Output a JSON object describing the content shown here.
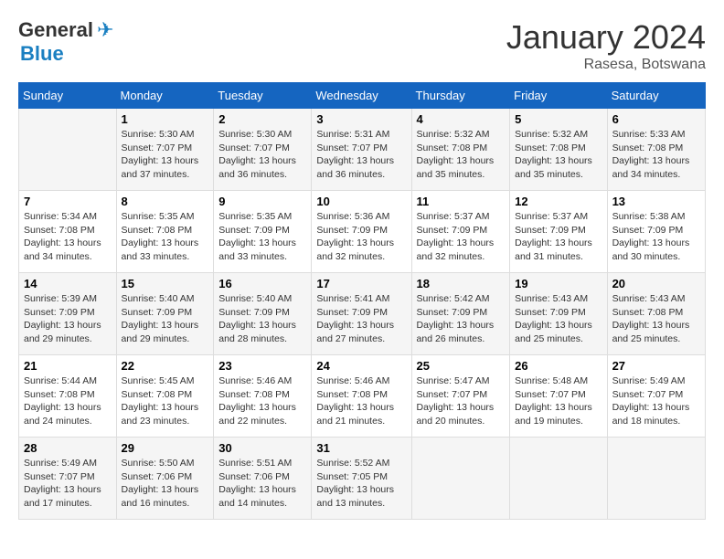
{
  "header": {
    "logo_general": "General",
    "logo_blue": "Blue",
    "month_title": "January 2024",
    "location": "Rasesa, Botswana"
  },
  "columns": [
    "Sunday",
    "Monday",
    "Tuesday",
    "Wednesday",
    "Thursday",
    "Friday",
    "Saturday"
  ],
  "weeks": [
    [
      {
        "day": "",
        "sunrise": "",
        "sunset": "",
        "daylight": ""
      },
      {
        "day": "1",
        "sunrise": "Sunrise: 5:30 AM",
        "sunset": "Sunset: 7:07 PM",
        "daylight": "Daylight: 13 hours and 37 minutes."
      },
      {
        "day": "2",
        "sunrise": "Sunrise: 5:30 AM",
        "sunset": "Sunset: 7:07 PM",
        "daylight": "Daylight: 13 hours and 36 minutes."
      },
      {
        "day": "3",
        "sunrise": "Sunrise: 5:31 AM",
        "sunset": "Sunset: 7:07 PM",
        "daylight": "Daylight: 13 hours and 36 minutes."
      },
      {
        "day": "4",
        "sunrise": "Sunrise: 5:32 AM",
        "sunset": "Sunset: 7:08 PM",
        "daylight": "Daylight: 13 hours and 35 minutes."
      },
      {
        "day": "5",
        "sunrise": "Sunrise: 5:32 AM",
        "sunset": "Sunset: 7:08 PM",
        "daylight": "Daylight: 13 hours and 35 minutes."
      },
      {
        "day": "6",
        "sunrise": "Sunrise: 5:33 AM",
        "sunset": "Sunset: 7:08 PM",
        "daylight": "Daylight: 13 hours and 34 minutes."
      }
    ],
    [
      {
        "day": "7",
        "sunrise": "Sunrise: 5:34 AM",
        "sunset": "Sunset: 7:08 PM",
        "daylight": "Daylight: 13 hours and 34 minutes."
      },
      {
        "day": "8",
        "sunrise": "Sunrise: 5:35 AM",
        "sunset": "Sunset: 7:08 PM",
        "daylight": "Daylight: 13 hours and 33 minutes."
      },
      {
        "day": "9",
        "sunrise": "Sunrise: 5:35 AM",
        "sunset": "Sunset: 7:09 PM",
        "daylight": "Daylight: 13 hours and 33 minutes."
      },
      {
        "day": "10",
        "sunrise": "Sunrise: 5:36 AM",
        "sunset": "Sunset: 7:09 PM",
        "daylight": "Daylight: 13 hours and 32 minutes."
      },
      {
        "day": "11",
        "sunrise": "Sunrise: 5:37 AM",
        "sunset": "Sunset: 7:09 PM",
        "daylight": "Daylight: 13 hours and 32 minutes."
      },
      {
        "day": "12",
        "sunrise": "Sunrise: 5:37 AM",
        "sunset": "Sunset: 7:09 PM",
        "daylight": "Daylight: 13 hours and 31 minutes."
      },
      {
        "day": "13",
        "sunrise": "Sunrise: 5:38 AM",
        "sunset": "Sunset: 7:09 PM",
        "daylight": "Daylight: 13 hours and 30 minutes."
      }
    ],
    [
      {
        "day": "14",
        "sunrise": "Sunrise: 5:39 AM",
        "sunset": "Sunset: 7:09 PM",
        "daylight": "Daylight: 13 hours and 29 minutes."
      },
      {
        "day": "15",
        "sunrise": "Sunrise: 5:40 AM",
        "sunset": "Sunset: 7:09 PM",
        "daylight": "Daylight: 13 hours and 29 minutes."
      },
      {
        "day": "16",
        "sunrise": "Sunrise: 5:40 AM",
        "sunset": "Sunset: 7:09 PM",
        "daylight": "Daylight: 13 hours and 28 minutes."
      },
      {
        "day": "17",
        "sunrise": "Sunrise: 5:41 AM",
        "sunset": "Sunset: 7:09 PM",
        "daylight": "Daylight: 13 hours and 27 minutes."
      },
      {
        "day": "18",
        "sunrise": "Sunrise: 5:42 AM",
        "sunset": "Sunset: 7:09 PM",
        "daylight": "Daylight: 13 hours and 26 minutes."
      },
      {
        "day": "19",
        "sunrise": "Sunrise: 5:43 AM",
        "sunset": "Sunset: 7:09 PM",
        "daylight": "Daylight: 13 hours and 25 minutes."
      },
      {
        "day": "20",
        "sunrise": "Sunrise: 5:43 AM",
        "sunset": "Sunset: 7:08 PM",
        "daylight": "Daylight: 13 hours and 25 minutes."
      }
    ],
    [
      {
        "day": "21",
        "sunrise": "Sunrise: 5:44 AM",
        "sunset": "Sunset: 7:08 PM",
        "daylight": "Daylight: 13 hours and 24 minutes."
      },
      {
        "day": "22",
        "sunrise": "Sunrise: 5:45 AM",
        "sunset": "Sunset: 7:08 PM",
        "daylight": "Daylight: 13 hours and 23 minutes."
      },
      {
        "day": "23",
        "sunrise": "Sunrise: 5:46 AM",
        "sunset": "Sunset: 7:08 PM",
        "daylight": "Daylight: 13 hours and 22 minutes."
      },
      {
        "day": "24",
        "sunrise": "Sunrise: 5:46 AM",
        "sunset": "Sunset: 7:08 PM",
        "daylight": "Daylight: 13 hours and 21 minutes."
      },
      {
        "day": "25",
        "sunrise": "Sunrise: 5:47 AM",
        "sunset": "Sunset: 7:07 PM",
        "daylight": "Daylight: 13 hours and 20 minutes."
      },
      {
        "day": "26",
        "sunrise": "Sunrise: 5:48 AM",
        "sunset": "Sunset: 7:07 PM",
        "daylight": "Daylight: 13 hours and 19 minutes."
      },
      {
        "day": "27",
        "sunrise": "Sunrise: 5:49 AM",
        "sunset": "Sunset: 7:07 PM",
        "daylight": "Daylight: 13 hours and 18 minutes."
      }
    ],
    [
      {
        "day": "28",
        "sunrise": "Sunrise: 5:49 AM",
        "sunset": "Sunset: 7:07 PM",
        "daylight": "Daylight: 13 hours and 17 minutes."
      },
      {
        "day": "29",
        "sunrise": "Sunrise: 5:50 AM",
        "sunset": "Sunset: 7:06 PM",
        "daylight": "Daylight: 13 hours and 16 minutes."
      },
      {
        "day": "30",
        "sunrise": "Sunrise: 5:51 AM",
        "sunset": "Sunset: 7:06 PM",
        "daylight": "Daylight: 13 hours and 14 minutes."
      },
      {
        "day": "31",
        "sunrise": "Sunrise: 5:52 AM",
        "sunset": "Sunset: 7:05 PM",
        "daylight": "Daylight: 13 hours and 13 minutes."
      },
      {
        "day": "",
        "sunrise": "",
        "sunset": "",
        "daylight": ""
      },
      {
        "day": "",
        "sunrise": "",
        "sunset": "",
        "daylight": ""
      },
      {
        "day": "",
        "sunrise": "",
        "sunset": "",
        "daylight": ""
      }
    ]
  ]
}
